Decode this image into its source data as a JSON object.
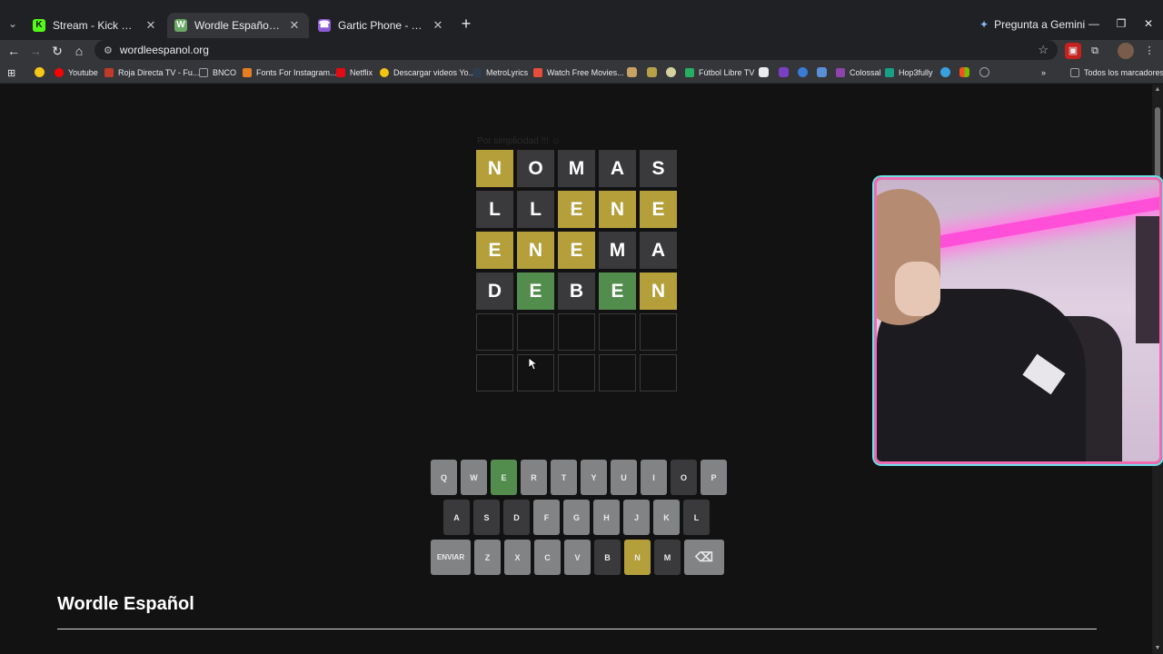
{
  "browser": {
    "tabs": [
      {
        "title": "Stream - Kick Dashboard",
        "favicon": "K",
        "favicon_color": "#53fc18",
        "active": false
      },
      {
        "title": "Wordle Español - Wordle ilimitado",
        "favicon": "W",
        "favicon_color": "#6aaa64",
        "active": true
      },
      {
        "title": "Gartic Phone - Teléfono Desconocido",
        "favicon": "☎",
        "favicon_color": "#8e5ad6",
        "active": false
      }
    ],
    "gemini_label": "Pregunta a Gemini",
    "url": "wordleespanol.org",
    "bookmarks": [
      {
        "label": "Youtube",
        "color": "#ff0000"
      },
      {
        "label": "Roja Directa TV - Fu...",
        "color": "#c0392b"
      },
      {
        "label": "BNCO",
        "color": "#9aa0a6"
      },
      {
        "label": "Fonts For Instagram...",
        "color": "#e67e22"
      },
      {
        "label": "Netflix",
        "color": "#e50914"
      },
      {
        "label": "Descargar videos Yo...",
        "color": "#f1c40f"
      },
      {
        "label": "MetroLyrics",
        "color": "#2c3e50"
      },
      {
        "label": "Watch Free Movies...",
        "color": "#e74c3c"
      },
      {
        "label": "Fútbol Libre TV",
        "color": "#27ae60"
      },
      {
        "label": "Colossal",
        "color": "#8e44ad"
      },
      {
        "label": "Hop3fully",
        "color": "#16a085"
      },
      {
        "label": "Todos los marcadores",
        "color": "#9aa0a6"
      }
    ]
  },
  "game": {
    "ghost_text": "Por simplicidad !!! ☺",
    "board": [
      [
        {
          "l": "N",
          "s": "yellow"
        },
        {
          "l": "O",
          "s": "gray"
        },
        {
          "l": "M",
          "s": "gray"
        },
        {
          "l": "A",
          "s": "gray"
        },
        {
          "l": "S",
          "s": "gray"
        }
      ],
      [
        {
          "l": "L",
          "s": "gray"
        },
        {
          "l": "L",
          "s": "gray"
        },
        {
          "l": "E",
          "s": "yellow"
        },
        {
          "l": "N",
          "s": "yellow"
        },
        {
          "l": "E",
          "s": "yellow"
        }
      ],
      [
        {
          "l": "E",
          "s": "yellow"
        },
        {
          "l": "N",
          "s": "yellow"
        },
        {
          "l": "E",
          "s": "yellow"
        },
        {
          "l": "M",
          "s": "gray"
        },
        {
          "l": "A",
          "s": "gray"
        }
      ],
      [
        {
          "l": "D",
          "s": "gray"
        },
        {
          "l": "E",
          "s": "green"
        },
        {
          "l": "B",
          "s": "gray"
        },
        {
          "l": "E",
          "s": "green"
        },
        {
          "l": "N",
          "s": "yellow"
        }
      ],
      [
        {
          "l": "",
          "s": "empty"
        },
        {
          "l": "",
          "s": "empty"
        },
        {
          "l": "",
          "s": "empty"
        },
        {
          "l": "",
          "s": "empty"
        },
        {
          "l": "",
          "s": "empty"
        }
      ],
      [
        {
          "l": "",
          "s": "empty"
        },
        {
          "l": "",
          "s": "empty"
        },
        {
          "l": "",
          "s": "empty"
        },
        {
          "l": "",
          "s": "empty"
        },
        {
          "l": "",
          "s": "empty"
        }
      ]
    ],
    "keyboard": [
      [
        {
          "k": "Q",
          "s": "unused"
        },
        {
          "k": "W",
          "s": "unused"
        },
        {
          "k": "E",
          "s": "green"
        },
        {
          "k": "R",
          "s": "unused"
        },
        {
          "k": "T",
          "s": "unused"
        },
        {
          "k": "Y",
          "s": "unused"
        },
        {
          "k": "U",
          "s": "unused"
        },
        {
          "k": "I",
          "s": "unused"
        },
        {
          "k": "O",
          "s": "used"
        },
        {
          "k": "P",
          "s": "unused"
        }
      ],
      [
        {
          "k": "A",
          "s": "used"
        },
        {
          "k": "S",
          "s": "used"
        },
        {
          "k": "D",
          "s": "used"
        },
        {
          "k": "F",
          "s": "unused"
        },
        {
          "k": "G",
          "s": "unused"
        },
        {
          "k": "H",
          "s": "unused"
        },
        {
          "k": "J",
          "s": "unused"
        },
        {
          "k": "K",
          "s": "unused"
        },
        {
          "k": "L",
          "s": "used"
        }
      ],
      [
        {
          "k": "ENVIAR",
          "s": "unused"
        },
        {
          "k": "Z",
          "s": "unused"
        },
        {
          "k": "X",
          "s": "unused"
        },
        {
          "k": "C",
          "s": "unused"
        },
        {
          "k": "V",
          "s": "unused"
        },
        {
          "k": "B",
          "s": "used"
        },
        {
          "k": "N",
          "s": "yellow"
        },
        {
          "k": "M",
          "s": "used"
        },
        {
          "k": "⌫",
          "s": "unused"
        }
      ]
    ],
    "page_title": "Wordle Español"
  }
}
